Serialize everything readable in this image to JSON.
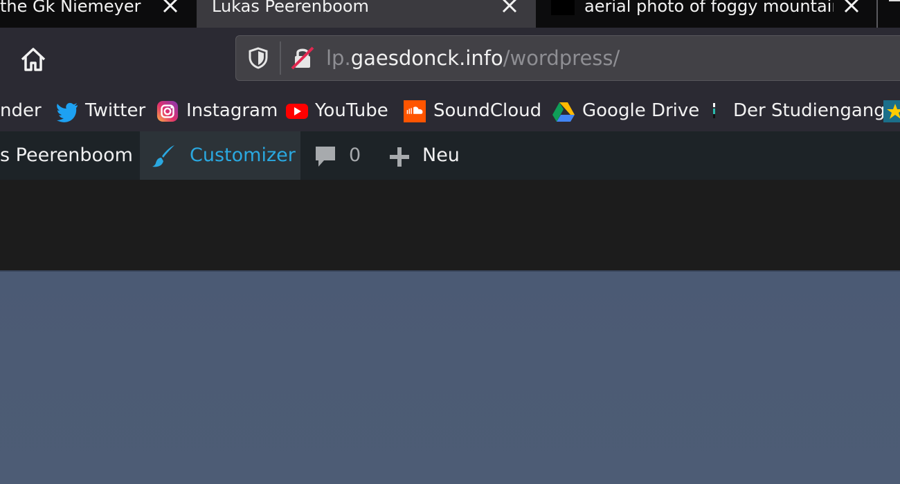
{
  "tabs": [
    {
      "title": "the Gk Niemeyer",
      "active": false
    },
    {
      "title": "Lukas Peerenboom",
      "active": true
    },
    {
      "title": "aerial photo of foggy mountain",
      "active": false
    }
  ],
  "urlbar": {
    "prefix": "lp.",
    "domain": "gaesdonck.info",
    "path": "/wordpress/"
  },
  "bookmarks": [
    {
      "label": "nder",
      "icon": "calendar-icon"
    },
    {
      "label": "Twitter",
      "icon": "twitter-icon"
    },
    {
      "label": "Instagram",
      "icon": "instagram-icon"
    },
    {
      "label": "YouTube",
      "icon": "youtube-icon"
    },
    {
      "label": "SoundCloud",
      "icon": "soundcloud-icon"
    },
    {
      "label": "Google Drive",
      "icon": "google-drive-icon"
    },
    {
      "label": "Der Studiengang",
      "icon": "bookmark-favicon-icon"
    },
    {
      "label": "",
      "icon": "star-icon"
    }
  ],
  "adminbar": {
    "site_name": "s Peerenboom",
    "customizer": "Customizer",
    "comments_count": "0",
    "new_label": "Neu"
  },
  "colors": {
    "accent_customizer": "#2aa8e0",
    "twitter": "#1da1f2",
    "youtube": "#ff0000",
    "soundcloud": "#ff5500"
  }
}
